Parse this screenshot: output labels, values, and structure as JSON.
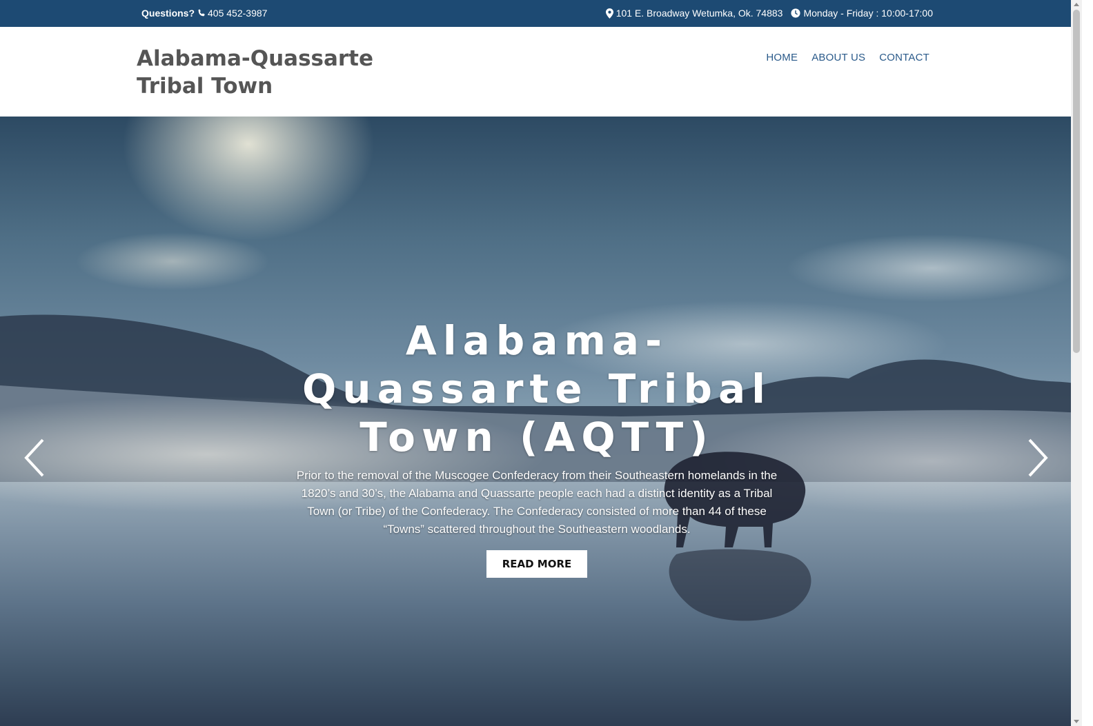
{
  "topbar": {
    "questions_label": "Questions?",
    "phone": "405 452-3987",
    "address": "101 E. Broadway Wetumka, Ok. 74883",
    "hours": "Monday - Friday : 10:00-17:00",
    "icons": [
      "phone-icon",
      "map-marker-icon",
      "clock-icon"
    ],
    "background": "#1d4a73"
  },
  "header": {
    "site_title": "Alabama-Quassarte Tribal Town",
    "nav": [
      {
        "label": "HOME"
      },
      {
        "label": "ABOUT US"
      },
      {
        "label": "CONTACT"
      }
    ],
    "nav_color": "#2a5a8a"
  },
  "hero": {
    "title": "Alabama-Quassarte Tribal Town (AQTT)",
    "text": "Prior to the removal of the Muscogee Confederacy from their Southeastern homelands in the 1820’s and 30’s, the Alabama and Quassarte people each had a distinct identity as a Tribal Town (or Tribe) of the Confederacy. The Confederacy consisted of more than 44 of these “Towns” scattered throughout the Southeastern woodlands.",
    "button_label": "READ MORE",
    "icons": [
      "chevron-left-icon",
      "chevron-right-icon"
    ]
  }
}
